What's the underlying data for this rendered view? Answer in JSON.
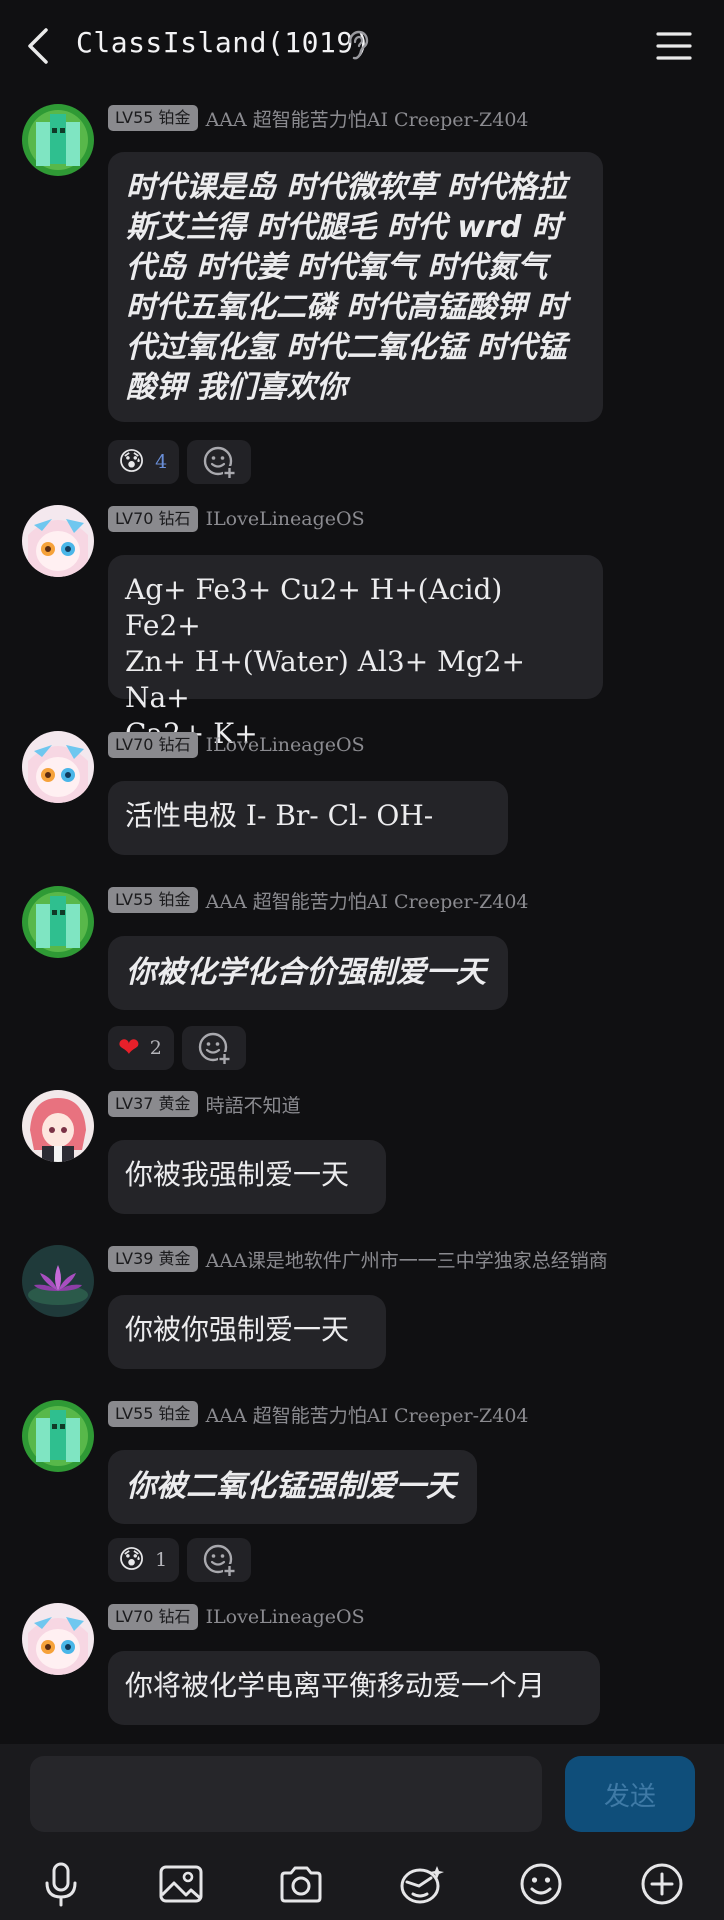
{
  "header": {
    "title": "ClassIsland(1019)"
  },
  "messages": [
    {
      "badge": "LV55 铂金",
      "sender": "AAA 超智能苦力怕AI Creeper-Z404",
      "text": "时代课是岛 时代微软草 时代格拉斯艾兰得 时代腿毛 时代 wrd 时代岛 时代姜 时代氧气 时代氮气 时代五氧化二磷 时代高锰酸钾 时代过氧化氢 时代二氧化锰 时代锰酸钾 我们喜欢你",
      "lines": [
        "时代课是岛 时代微软草 时代格拉",
        "斯艾兰得 时代腿毛 时代 wrd 时",
        "代岛 时代姜 时代氧气 时代氮气",
        "时代五氧化二磷 时代高锰酸钾 时",
        "代过氧化氢 时代二氧化锰 时代锰",
        "酸钾 我们喜欢你"
      ],
      "reaction": {
        "emoji": "😰",
        "count": "4"
      }
    },
    {
      "badge": "LV70 钻石",
      "sender": "ILoveLineageOS",
      "lines": [
        "Ag+ Fe3+ Cu2+ H+(Acid) Fe2+",
        "Zn+ H+(Water) Al3+ Mg2+ Na+",
        "Ca2+ K+"
      ]
    },
    {
      "badge": "LV70 钻石",
      "sender": "ILoveLineageOS",
      "lines": [
        "活性电极 I- Br- Cl- OH-"
      ]
    },
    {
      "badge": "LV55 铂金",
      "sender": "AAA 超智能苦力怕AI Creeper-Z404",
      "lines": [
        "你被化学化合价强制爱一天"
      ],
      "reaction": {
        "emoji": "❤️",
        "count": "2"
      }
    },
    {
      "badge": "LV37 黄金",
      "sender": "時語不知道",
      "lines": [
        "你被我强制爱一天"
      ]
    },
    {
      "badge": "LV39 黄金",
      "sender": "AAA课是地软件广州市一一三中学独家总经销商",
      "lines": [
        "你被你强制爱一天"
      ]
    },
    {
      "badge": "LV55 铂金",
      "sender": "AAA 超智能苦力怕AI Creeper-Z404",
      "lines": [
        "你被二氧化锰强制爱一天"
      ],
      "reaction": {
        "emoji": "😰",
        "count": "1"
      }
    },
    {
      "badge": "LV70 钻石",
      "sender": "ILoveLineageOS",
      "lines": [
        "你将被化学电离平衡移动爱一个月"
      ]
    }
  ],
  "composer": {
    "input_value": "",
    "send_label": "发送"
  },
  "colors": {
    "background": "#101012",
    "bubble": "#242428",
    "send": "#0f4e7a",
    "badge": "#8a8a8e"
  },
  "toolbar_icons": [
    "microphone-icon",
    "image-icon",
    "camera-icon",
    "sticker-icon",
    "emoji-icon",
    "plus-icon"
  ]
}
